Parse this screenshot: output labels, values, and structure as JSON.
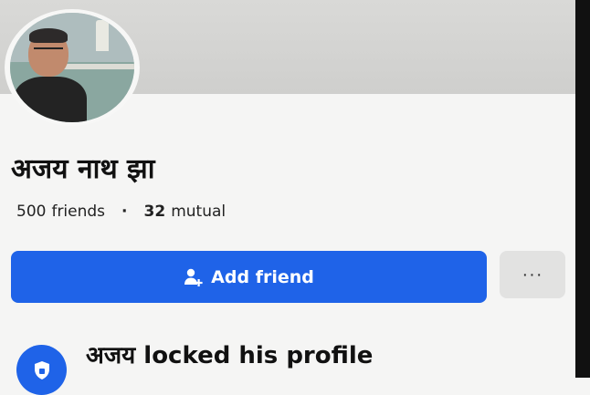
{
  "profile": {
    "name": "अजय नाथ झा",
    "friends_count": "500",
    "friends_label": "friends",
    "separator": "·",
    "mutual_count": "32",
    "mutual_label": "mutual"
  },
  "actions": {
    "add_friend_label": "Add friend",
    "more_label": "···"
  },
  "notice": {
    "locked_text": "अजय locked his profile"
  },
  "colors": {
    "accent": "#1f63e8",
    "page_bg": "#f5f5f4",
    "secondary_button_bg": "#e2e2e1"
  },
  "icons": {
    "add_friend": "person-add-icon",
    "lock": "shield-lock-icon",
    "more": "more-dots-icon"
  }
}
